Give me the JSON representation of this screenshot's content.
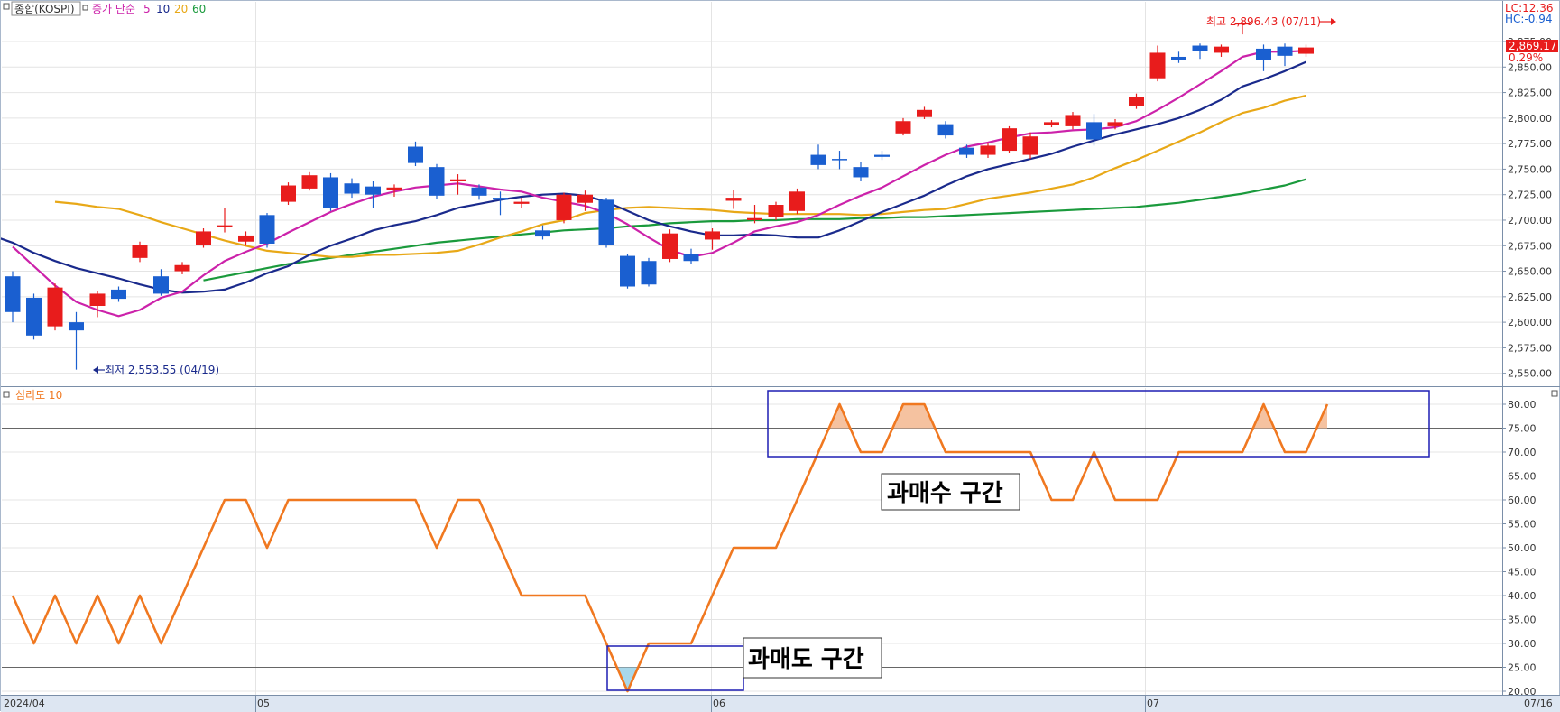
{
  "upper_panel": {
    "legend_symbol": "종합(KOSPI)",
    "legend_ma_title": "종가 단순",
    "legend_ma_periods": [
      "5",
      "10",
      "20",
      "60"
    ],
    "legend_ma_colors": [
      "#cc22aa",
      "#1a2a8c",
      "#e8a817",
      "#1a9a3c"
    ],
    "lc_text": "LC:12.36",
    "hc_text": "HC:-0.94",
    "current_price_text": "2,869.17",
    "current_change_text": "0.29%",
    "high_annotation": "최고 2,896.43 (07/11)",
    "low_annotation": "최저 2,553.55 (04/19)"
  },
  "lower_panel": {
    "legend_title": "심리도 10",
    "overbought_label": "과매수 구간",
    "oversold_label": "과매도 구간"
  },
  "x_axis_labels": [
    "2024/04",
    "05",
    "06",
    "07",
    "07/16"
  ],
  "colors": {
    "up_candle": "#e81c1c",
    "down_candle": "#1a5fd0",
    "psy_line": "#f07820",
    "box_border": "#1e1eb4",
    "upper_fill": "#f5c2a0",
    "lower_fill": "#a8d8ea"
  },
  "chart_data": [
    {
      "type": "candlestick",
      "title": "종합(KOSPI)",
      "ylim": [
        2540,
        2890
      ],
      "y_ticks": [
        "2,875.00",
        "2,850.00",
        "2,825.00",
        "2,800.00",
        "2,775.00",
        "2,750.00",
        "2,725.00",
        "2,700.00",
        "2,675.00",
        "2,650.00",
        "2,625.00",
        "2,600.00",
        "2,575.00",
        "2,550.00"
      ],
      "candles": [
        {
          "o": 2645,
          "c": 2610,
          "h": 2650,
          "l": 2600
        },
        {
          "o": 2624,
          "c": 2587,
          "h": 2628,
          "l": 2583
        },
        {
          "o": 2596,
          "c": 2634,
          "h": 2638,
          "l": 2592
        },
        {
          "o": 2600,
          "c": 2592,
          "h": 2610,
          "l": 2553.55
        },
        {
          "o": 2616,
          "c": 2628,
          "h": 2631,
          "l": 2605
        },
        {
          "o": 2632,
          "c": 2623,
          "h": 2635,
          "l": 2620
        },
        {
          "o": 2663,
          "c": 2676,
          "h": 2679,
          "l": 2659
        },
        {
          "o": 2645,
          "c": 2628,
          "h": 2652,
          "l": 2626
        },
        {
          "o": 2650,
          "c": 2656,
          "h": 2659,
          "l": 2647
        },
        {
          "o": 2676,
          "c": 2689,
          "h": 2692,
          "l": 2673
        },
        {
          "o": 2693,
          "c": 2695,
          "h": 2712,
          "l": 2688
        },
        {
          "o": 2679,
          "c": 2685,
          "h": 2689,
          "l": 2675
        },
        {
          "o": 2705,
          "c": 2677,
          "h": 2707,
          "l": 2673
        },
        {
          "o": 2718,
          "c": 2734,
          "h": 2737,
          "l": 2715
        },
        {
          "o": 2731,
          "c": 2744,
          "h": 2747,
          "l": 2729
        },
        {
          "o": 2742,
          "c": 2712,
          "h": 2746,
          "l": 2709
        },
        {
          "o": 2736,
          "c": 2726,
          "h": 2741,
          "l": 2722
        },
        {
          "o": 2733,
          "c": 2725,
          "h": 2738,
          "l": 2712
        },
        {
          "o": 2730,
          "c": 2732,
          "h": 2735,
          "l": 2723
        },
        {
          "o": 2772,
          "c": 2756,
          "h": 2777,
          "l": 2753
        },
        {
          "o": 2752,
          "c": 2724,
          "h": 2755,
          "l": 2721
        },
        {
          "o": 2738,
          "c": 2740,
          "h": 2745,
          "l": 2725
        },
        {
          "o": 2732,
          "c": 2724,
          "h": 2735,
          "l": 2720
        },
        {
          "o": 2722,
          "c": 2720,
          "h": 2728,
          "l": 2705
        },
        {
          "o": 2716,
          "c": 2718,
          "h": 2722,
          "l": 2712
        },
        {
          "o": 2690,
          "c": 2684,
          "h": 2695,
          "l": 2681
        },
        {
          "o": 2700,
          "c": 2725,
          "h": 2727,
          "l": 2697
        },
        {
          "o": 2717,
          "c": 2725,
          "h": 2729,
          "l": 2709
        },
        {
          "o": 2720,
          "c": 2676,
          "h": 2722,
          "l": 2673
        },
        {
          "o": 2665,
          "c": 2635,
          "h": 2667,
          "l": 2633
        },
        {
          "o": 2660,
          "c": 2637,
          "h": 2663,
          "l": 2635
        },
        {
          "o": 2662,
          "c": 2687,
          "h": 2691,
          "l": 2659
        },
        {
          "o": 2667,
          "c": 2660,
          "h": 2672,
          "l": 2657
        },
        {
          "o": 2681,
          "c": 2689,
          "h": 2692,
          "l": 2671
        },
        {
          "o": 2719,
          "c": 2722,
          "h": 2730,
          "l": 2711
        },
        {
          "o": 2700,
          "c": 2702,
          "h": 2715,
          "l": 2697
        },
        {
          "o": 2703,
          "c": 2715,
          "h": 2718,
          "l": 2700
        },
        {
          "o": 2709,
          "c": 2728,
          "h": 2731,
          "l": 2706
        },
        {
          "o": 2764,
          "c": 2754,
          "h": 2774,
          "l": 2750
        },
        {
          "o": 2760,
          "c": 2759,
          "h": 2768,
          "l": 2750
        },
        {
          "o": 2752,
          "c": 2742,
          "h": 2757,
          "l": 2738
        },
        {
          "o": 2764,
          "c": 2762,
          "h": 2768,
          "l": 2759
        },
        {
          "o": 2785,
          "c": 2797,
          "h": 2800,
          "l": 2783
        },
        {
          "o": 2801,
          "c": 2808,
          "h": 2811,
          "l": 2799
        },
        {
          "o": 2794,
          "c": 2783,
          "h": 2797,
          "l": 2780
        },
        {
          "o": 2771,
          "c": 2764,
          "h": 2774,
          "l": 2761
        },
        {
          "o": 2764,
          "c": 2773,
          "h": 2776,
          "l": 2761
        },
        {
          "o": 2768,
          "c": 2790,
          "h": 2792,
          "l": 2766
        },
        {
          "o": 2764,
          "c": 2782,
          "h": 2786,
          "l": 2760
        },
        {
          "o": 2793,
          "c": 2796,
          "h": 2798,
          "l": 2791
        },
        {
          "o": 2792,
          "c": 2803,
          "h": 2806,
          "l": 2789
        },
        {
          "o": 2796,
          "c": 2779,
          "h": 2804,
          "l": 2773
        },
        {
          "o": 2792,
          "c": 2796,
          "h": 2799,
          "l": 2789
        },
        {
          "o": 2812,
          "c": 2821,
          "h": 2824,
          "l": 2809
        },
        {
          "o": 2839,
          "c": 2864,
          "h": 2871,
          "l": 2836
        },
        {
          "o": 2860,
          "c": 2857,
          "h": 2865,
          "l": 2854
        },
        {
          "o": 2871,
          "c": 2866,
          "h": 2873,
          "l": 2858
        },
        {
          "o": 2864,
          "c": 2870,
          "h": 2872,
          "l": 2860
        },
        {
          "o": 2892,
          "c": 2893,
          "h": 2896.43,
          "l": 2882
        },
        {
          "o": 2868,
          "c": 2857,
          "h": 2872,
          "l": 2846
        },
        {
          "o": 2870,
          "c": 2861,
          "h": 2873,
          "l": 2851
        },
        {
          "o": 2863,
          "c": 2869.17,
          "h": 2872,
          "l": 2860
        }
      ],
      "series": [
        {
          "name": "5",
          "color": "#cc22aa",
          "values": [
            2674,
            2655,
            2636,
            2620,
            2612,
            2606,
            2612,
            2624,
            2630,
            2646,
            2660,
            2669,
            2677,
            2688,
            2698,
            2708,
            2716,
            2723,
            2728,
            2732,
            2734,
            2736,
            2733,
            2730,
            2728,
            2722,
            2718,
            2714,
            2707,
            2696,
            2683,
            2671,
            2664,
            2668,
            2678,
            2689,
            2694,
            2698,
            2705,
            2715,
            2724,
            2732,
            2743,
            2754,
            2764,
            2772,
            2776,
            2781,
            2785,
            2786,
            2788,
            2789,
            2791,
            2797,
            2808,
            2820,
            2833,
            2846,
            2860,
            2865,
            2865,
            2866
          ]
        },
        {
          "name": "10",
          "color": "#1a2a8c",
          "values": [
            2702,
            2685,
            2678,
            2668,
            2660,
            2653,
            2648,
            2643,
            2637,
            2632,
            2629,
            2630,
            2632,
            2639,
            2648,
            2655,
            2666,
            2675,
            2682,
            2690,
            2695,
            2699,
            2705,
            2712,
            2716,
            2720,
            2723,
            2725,
            2726,
            2724,
            2718,
            2709,
            2700,
            2694,
            2689,
            2685,
            2685,
            2686,
            2685,
            2683,
            2683,
            2690,
            2699,
            2708,
            2716,
            2724,
            2734,
            2743,
            2750,
            2755,
            2760,
            2765,
            2772,
            2778,
            2784,
            2789,
            2794,
            2800,
            2808,
            2818,
            2831,
            2838,
            2846,
            2855
          ]
        },
        {
          "name": "20",
          "color": "#e8a817",
          "values": [
            2718,
            2716,
            2713,
            2711,
            2705,
            2698,
            2692,
            2686,
            2680,
            2675,
            2670,
            2668,
            2666,
            2664,
            2664,
            2666,
            2666,
            2667,
            2668,
            2670,
            2676,
            2683,
            2689,
            2696,
            2700,
            2707,
            2710,
            2712,
            2713,
            2712,
            2711,
            2710,
            2708,
            2707,
            2706,
            2706,
            2706,
            2706,
            2705,
            2706,
            2708,
            2710,
            2711,
            2716,
            2721,
            2724,
            2727,
            2731,
            2735,
            2742,
            2751,
            2759,
            2768,
            2777,
            2786,
            2796,
            2805,
            2810,
            2817,
            2822
          ]
        },
        {
          "name": "60",
          "color": "#1a9a3c",
          "values": [
            2641,
            2645,
            2649,
            2653,
            2657,
            2660,
            2663,
            2666,
            2669,
            2672,
            2675,
            2678,
            2680,
            2682,
            2684,
            2686,
            2688,
            2690,
            2691,
            2692,
            2694,
            2695,
            2697,
            2698,
            2699,
            2699,
            2700,
            2700,
            2701,
            2701,
            2701,
            2702,
            2702,
            2703,
            2703,
            2704,
            2705,
            2706,
            2707,
            2708,
            2709,
            2710,
            2711,
            2712,
            2713,
            2715,
            2717,
            2720,
            2723,
            2726,
            2730,
            2734,
            2740
          ]
        }
      ]
    },
    {
      "type": "line",
      "title": "심리도 10",
      "ylim": [
        19,
        82
      ],
      "y_ticks": [
        "80.00",
        "75.00",
        "70.00",
        "65.00",
        "60.00",
        "55.00",
        "50.00",
        "45.00",
        "40.00",
        "35.00",
        "30.00",
        "25.00",
        "20.00"
      ],
      "reference_lines": [
        75,
        25
      ],
      "series": [
        {
          "name": "심리도 10",
          "color": "#f07820",
          "values": [
            40,
            30,
            40,
            30,
            40,
            30,
            40,
            30,
            40,
            50,
            60,
            60,
            50,
            60,
            60,
            60,
            60,
            60,
            60,
            60,
            50,
            60,
            60,
            50,
            40,
            40,
            40,
            40,
            30,
            20,
            30,
            30,
            30,
            40,
            50,
            50,
            50,
            60,
            70,
            80,
            70,
            70,
            80,
            80,
            70,
            70,
            70,
            70,
            70,
            60,
            60,
            70,
            60,
            60,
            60,
            70,
            70,
            70,
            70,
            80,
            70,
            70,
            80
          ]
        }
      ]
    }
  ]
}
